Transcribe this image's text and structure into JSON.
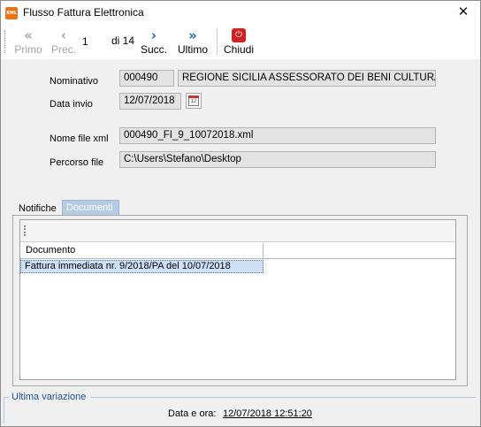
{
  "window": {
    "app_icon_text": "XML",
    "title": "Flusso Fattura Elettronica",
    "close_glyph": "✕"
  },
  "toolbar": {
    "first_label": "Primo",
    "first_icon": "chevrons-left-icon",
    "prev_label": "Prec.",
    "prev_icon": "chevron-left-icon",
    "current_record": "1",
    "record_of": "di 14",
    "next_label": "Succ.",
    "next_icon": "chevron-right-icon",
    "last_label": "Ultimo",
    "last_icon": "chevrons-right-icon",
    "close_label": "Chiudi",
    "close_icon": "power-icon"
  },
  "form": {
    "nominativo_label": "Nominativo",
    "nominativo_code": "000490",
    "nominativo_name": "REGIONE SICILIA ASSESSORATO DEI BENI CULTURALI",
    "data_invio_label": "Data invio",
    "data_invio_value": "12/07/2018",
    "calendar_day": "12",
    "nome_file_label": "Nome file xml",
    "nome_file_value": "000490_FI_9_10072018.xml",
    "percorso_label": "Percorso file",
    "percorso_value": "C:\\Users\\Stefano\\Desktop"
  },
  "tabs": [
    {
      "label": "Notifiche",
      "active": false
    },
    {
      "label": "Documenti",
      "active": true
    }
  ],
  "grid": {
    "columns": [
      "Documento",
      ""
    ],
    "rows": [
      {
        "documento": "Fattura immediata nr. 9/2018/PA del 10/07/2018",
        "selected": true
      }
    ]
  },
  "footer": {
    "legend": "Ultima variazione",
    "datetime_label": "Data e ora:",
    "datetime_value": "12/07/2018 12:51:20"
  },
  "colors": {
    "accent": "#1c5fb6",
    "active_tab": "#b5cde4",
    "selected_row": "#cfe0f6",
    "close_icon": "#d32020"
  }
}
